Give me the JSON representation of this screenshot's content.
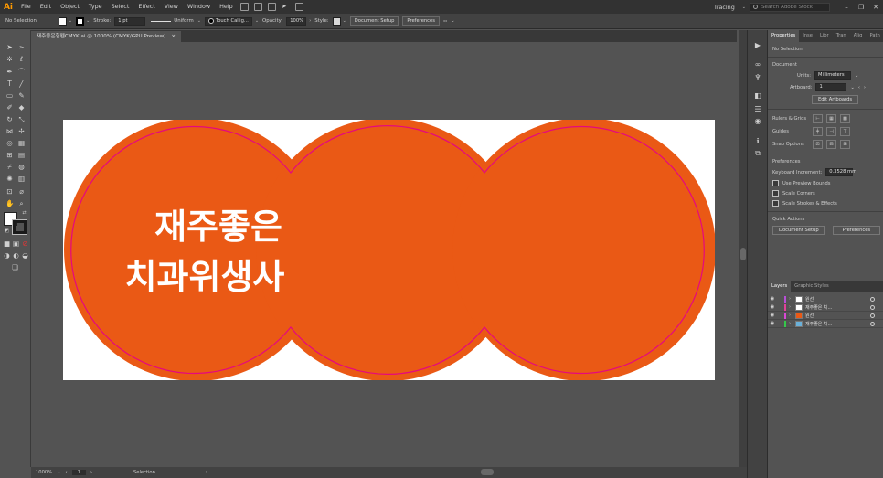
{
  "menubar": {
    "logo": "Ai",
    "items": [
      "File",
      "Edit",
      "Object",
      "Type",
      "Select",
      "Effect",
      "View",
      "Window",
      "Help"
    ],
    "workspace": "Tracing",
    "search_placeholder": "Search Adobe Stock"
  },
  "controlbar": {
    "selection": "No Selection",
    "stroke_label": "Stroke:",
    "stroke_weight": "1 pt",
    "stroke_profile": "Uniform",
    "brush": "Touch Callig...",
    "opacity_label": "Opacity:",
    "opacity": "100%",
    "style_label": "Style:",
    "document_setup": "Document Setup",
    "preferences": "Preferences"
  },
  "document": {
    "tab_title": "재주좋은형펜CMYK.ai @ 1000% (CMYK/GPU Preview)",
    "close": "×"
  },
  "artwork": {
    "line1": "재주좋은",
    "line2": "치과위생사",
    "fill_color": "#ea5915",
    "inner_stroke_color": "#e5087e",
    "text_color": "#ffffff"
  },
  "statusbar": {
    "zoom": "1000%",
    "artboard": "1",
    "mode": "Selection"
  },
  "properties": {
    "tabs": [
      "Properties",
      "Inse",
      "Libr",
      "Tran",
      "Alig",
      "Path"
    ],
    "no_selection": "No Selection",
    "document_title": "Document",
    "units_label": "Units:",
    "units": "Millimeters",
    "artboard_label": "Artboard:",
    "artboard_value": "1",
    "edit_artboards": "Edit Artboards",
    "rulers_grids": "Rulers & Grids",
    "guides": "Guides",
    "snap_options": "Snap Options",
    "preferences_title": "Preferences",
    "keyboard_increment_label": "Keyboard Increment:",
    "keyboard_increment": "0.3528 mm",
    "use_preview_bounds": "Use Preview Bounds",
    "scale_corners": "Scale Corners",
    "scale_strokes": "Scale Strokes & Effects",
    "quick_actions": "Quick Actions",
    "document_setup": "Document Setup",
    "preferences": "Preferences"
  },
  "layers": {
    "tabs": [
      "Layers",
      "Graphic Styles"
    ],
    "rows": [
      {
        "name": "원선",
        "color": "#b84fd6"
      },
      {
        "name": "재주좋은 치...",
        "color": "#e2409a"
      },
      {
        "name": "원선",
        "color": "#d947d4"
      },
      {
        "name": "재주좋은 치...",
        "color": "#35c84a"
      }
    ]
  }
}
